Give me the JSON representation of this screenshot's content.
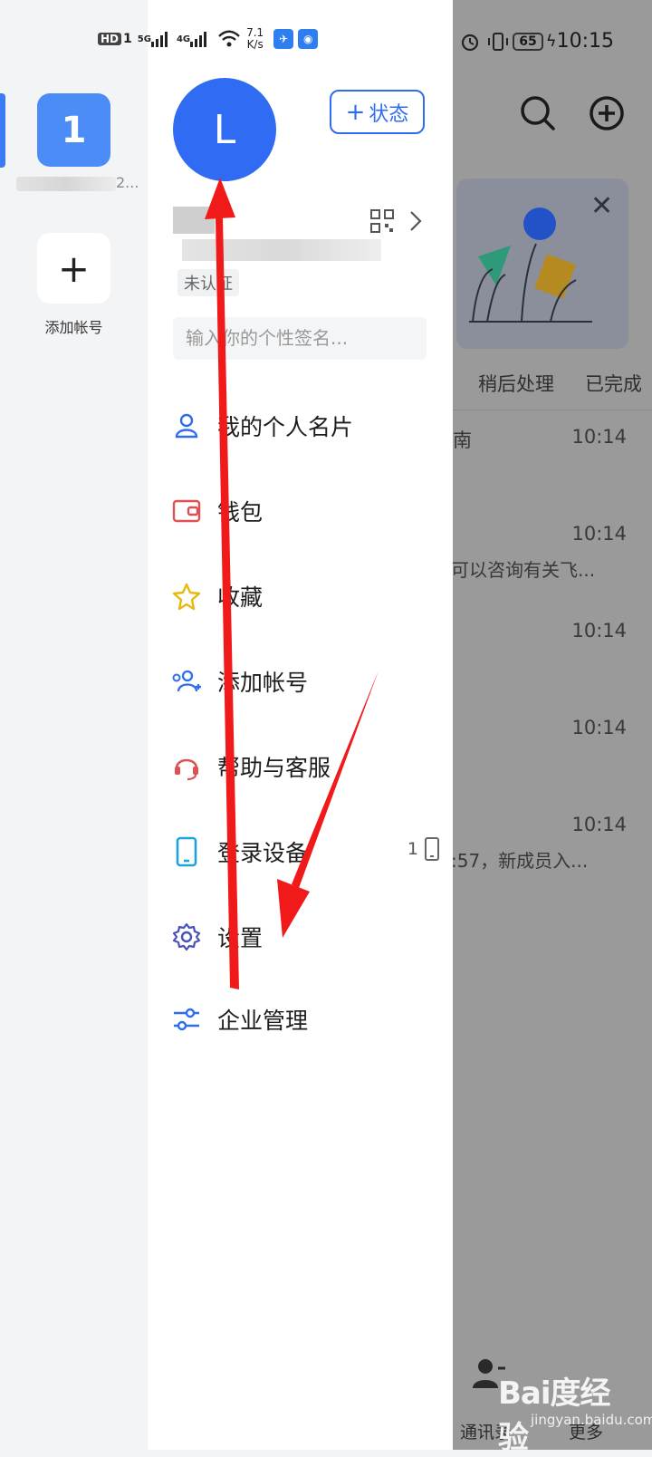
{
  "status_bar": {
    "hd": "HD",
    "sim1": "1",
    "net1": "5G",
    "net2": "4G",
    "speed_value": "7.1",
    "speed_unit": "K/s",
    "battery": "65",
    "time": "10:15"
  },
  "rail": {
    "account_initial": "1",
    "account_name_suffix": "2...",
    "add_label": "添加帐号"
  },
  "drawer": {
    "avatar_letter": "L",
    "status_button_label": "状态",
    "verify_badge": "未认证",
    "signature_placeholder": "输入你的个性签名...",
    "menu": [
      {
        "label": "我的个人名片",
        "icon": "person-icon"
      },
      {
        "label": "钱包",
        "icon": "wallet-icon"
      },
      {
        "label": "收藏",
        "icon": "star-icon"
      },
      {
        "label": "添加帐号",
        "icon": "add-people-icon"
      },
      {
        "label": "帮助与客服",
        "icon": "headset-icon"
      },
      {
        "label": "登录设备",
        "icon": "phone-icon"
      },
      {
        "label": "设置",
        "icon": "gear-icon"
      },
      {
        "label": "企业管理",
        "icon": "sliders-icon"
      }
    ],
    "device_count": "1"
  },
  "background": {
    "tabs": [
      "稍后处理",
      "已完成"
    ],
    "rows": [
      {
        "title": "南",
        "time": "10:14",
        "snippet": ""
      },
      {
        "title": "",
        "time": "10:14",
        "snippet": "可以咨询有关飞..."
      },
      {
        "title": "",
        "time": "10:14",
        "snippet": ""
      },
      {
        "title": "",
        "time": "10:14",
        "snippet": ""
      },
      {
        "title": "",
        "time": "10:14",
        "snippet": ":57，新成员入..."
      }
    ],
    "bottom_nav": [
      "通讯录",
      "更多"
    ]
  },
  "watermark": {
    "main": "Bai度经验",
    "sub": "jingyan.baidu.com"
  },
  "colors": {
    "accent": "#2f6cf3",
    "annotation": "#f01a1a",
    "dim_overlay": "#9a9a9a"
  }
}
